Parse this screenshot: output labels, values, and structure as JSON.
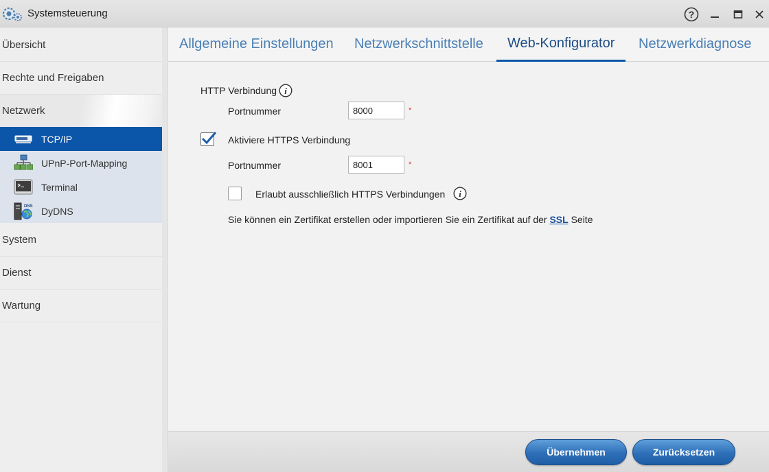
{
  "window": {
    "title": "Systemsteuerung",
    "app_icon": "gear-icon",
    "controls": [
      "help-icon",
      "minimize-icon",
      "maximize-icon",
      "close-icon"
    ]
  },
  "sidebar": {
    "items": [
      {
        "label": "Übersicht"
      },
      {
        "label": "Rechte und Freigaben"
      },
      {
        "label": "Netzwerk"
      },
      {
        "label": "System"
      },
      {
        "label": "Dienst"
      },
      {
        "label": "Wartung"
      }
    ],
    "submenu": [
      {
        "label": "TCP/IP",
        "icon": "network-card-icon"
      },
      {
        "label": "UPnP-Port-Mapping",
        "icon": "network-tree-icon"
      },
      {
        "label": "Terminal",
        "icon": "terminal-icon"
      },
      {
        "label": "DyDNS",
        "icon": "dns-globe-icon"
      }
    ]
  },
  "tabs": [
    {
      "label": "Allgemeine Einstellungen"
    },
    {
      "label": "Netzwerkschnittstelle"
    },
    {
      "label": "Web-Konfigurator"
    },
    {
      "label": "Netzwerkdiagnose"
    }
  ],
  "form": {
    "http_label": "HTTP Verbindung",
    "http_port_label": "Portnummer",
    "http_port_value": "8000",
    "https_enable_label": "Aktiviere HTTPS Verbindung",
    "https_enabled": true,
    "https_port_label": "Portnummer",
    "https_port_value": "8001",
    "https_only_label": "Erlaubt ausschließlich HTTPS Verbindungen",
    "https_only": false,
    "required_mark": "*",
    "cert_text_before": "Sie können ein Zertifikat erstellen oder importieren Sie ein Zertifikat auf der ",
    "cert_link": "SSL",
    "cert_text_after": " Seite"
  },
  "footer": {
    "apply_label": "Übernehmen",
    "reset_label": "Zurücksetzen"
  },
  "colors": {
    "accent": "#0b56a8",
    "tab_text": "#4a7fb5",
    "button": "#2e6fb8",
    "required": "#d9342b"
  }
}
